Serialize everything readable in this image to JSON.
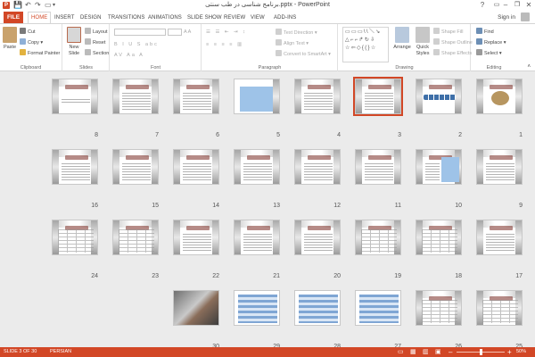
{
  "window": {
    "title": "برنامج شناسی در طب سنتی.pptx - PowerPoint",
    "help": "?",
    "min": "–",
    "restore": "❐",
    "close": "✕"
  },
  "tabs": {
    "file": "FILE",
    "items": [
      {
        "label": "HOME",
        "active": true
      },
      {
        "label": "INSERT"
      },
      {
        "label": "DESIGN"
      },
      {
        "label": "TRANSITIONS"
      },
      {
        "label": "ANIMATIONS"
      },
      {
        "label": "SLIDE SHOW"
      },
      {
        "label": "REVIEW"
      },
      {
        "label": "VIEW"
      },
      {
        "label": "ADD-INS"
      }
    ],
    "signin": "Sign in"
  },
  "ribbon": {
    "clipboard": {
      "label": "Clipboard",
      "paste": "Paste",
      "cut": "Cut",
      "copy": "Copy",
      "format_painter": "Format Painter"
    },
    "slides": {
      "label": "Slides",
      "new_slide": "New Slide",
      "layout": "Layout",
      "reset": "Reset",
      "section": "Section"
    },
    "font": {
      "label": "Font"
    },
    "paragraph": {
      "label": "Paragraph",
      "text_direction": "Text Direction",
      "align_text": "Align Text",
      "smartart": "Convert to SmartArt"
    },
    "drawing": {
      "label": "Drawing",
      "arrange": "Arrange",
      "quick_styles": "Quick Styles",
      "shape_fill": "Shape Fill",
      "shape_outline": "Shape Outline",
      "shape_effects": "Shape Effects"
    },
    "editing": {
      "label": "Editing",
      "find": "Find",
      "replace": "Replace",
      "select": "Select"
    }
  },
  "slides": [
    {
      "n": "1",
      "kind": "gears"
    },
    {
      "n": "2",
      "kind": "chain"
    },
    {
      "n": "3",
      "kind": "text",
      "selected": true
    },
    {
      "n": "4",
      "kind": "text"
    },
    {
      "n": "5",
      "kind": "blue"
    },
    {
      "n": "6",
      "kind": "text"
    },
    {
      "n": "7",
      "kind": "text"
    },
    {
      "n": "8",
      "kind": "title"
    },
    {
      "n": "9",
      "kind": "text"
    },
    {
      "n": "10",
      "kind": "bluecol"
    },
    {
      "n": "11",
      "kind": "text"
    },
    {
      "n": "12",
      "kind": "text"
    },
    {
      "n": "13",
      "kind": "text"
    },
    {
      "n": "14",
      "kind": "text"
    },
    {
      "n": "15",
      "kind": "text"
    },
    {
      "n": "16",
      "kind": "text"
    },
    {
      "n": "17",
      "kind": "text"
    },
    {
      "n": "18",
      "kind": "table"
    },
    {
      "n": "19",
      "kind": "table"
    },
    {
      "n": "20",
      "kind": "text"
    },
    {
      "n": "21",
      "kind": "text"
    },
    {
      "n": "22",
      "kind": "text"
    },
    {
      "n": "23",
      "kind": "table"
    },
    {
      "n": "24",
      "kind": "table"
    },
    {
      "n": "25",
      "kind": "table"
    },
    {
      "n": "26",
      "kind": "table"
    },
    {
      "n": "27",
      "kind": "bluetbl"
    },
    {
      "n": "28",
      "kind": "bluetbl"
    },
    {
      "n": "29",
      "kind": "bluetbl"
    },
    {
      "n": "30",
      "kind": "photo"
    }
  ],
  "status": {
    "slide": "SLIDE 3 OF 30",
    "language": "PERSIAN",
    "zoom": "50%",
    "zoom_level": 0.5
  }
}
